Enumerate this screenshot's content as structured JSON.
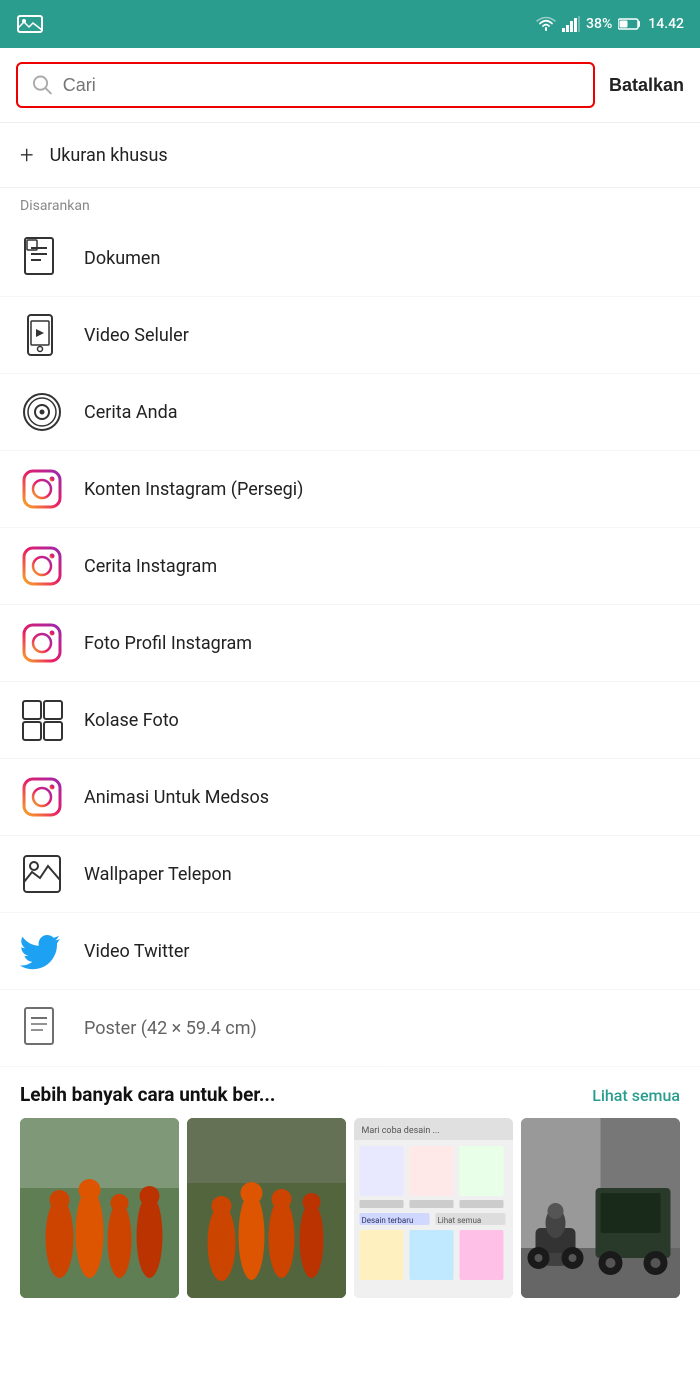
{
  "statusBar": {
    "wifi": "wifi",
    "signal": "signal",
    "battery": "38%",
    "time": "14.42"
  },
  "search": {
    "placeholder": "Cari",
    "cancelLabel": "Batalkan"
  },
  "customSize": {
    "icon": "plus",
    "label": "Ukuran khusus"
  },
  "suggestedLabel": "Disarankan",
  "items": [
    {
      "id": "dokumen",
      "label": "Dokumen",
      "iconType": "dokumen"
    },
    {
      "id": "video-seluler",
      "label": "Video Seluler",
      "iconType": "video-seluler"
    },
    {
      "id": "cerita-anda",
      "label": "Cerita Anda",
      "iconType": "cerita-anda"
    },
    {
      "id": "konten-instagram",
      "label": "Konten Instagram (Persegi)",
      "iconType": "instagram"
    },
    {
      "id": "cerita-instagram",
      "label": "Cerita Instagram",
      "iconType": "instagram-pink"
    },
    {
      "id": "foto-profil-instagram",
      "label": "Foto Profil Instagram",
      "iconType": "instagram-gradient"
    },
    {
      "id": "kolase-foto",
      "label": "Kolase Foto",
      "iconType": "kolase"
    },
    {
      "id": "animasi-medsos",
      "label": "Animasi Untuk Medsos",
      "iconType": "instagram-anim"
    },
    {
      "id": "wallpaper-telepon",
      "label": "Wallpaper Telepon",
      "iconType": "wallpaper"
    },
    {
      "id": "video-twitter",
      "label": "Video Twitter",
      "iconType": "twitter"
    },
    {
      "id": "poster",
      "label": "Poster (42 × 59.4 cm)",
      "iconType": "poster"
    }
  ],
  "bottomSection": {
    "title": "Lebih banyak cara untuk ber...",
    "seeAll": "Lihat semua"
  },
  "thumbnails": [
    {
      "id": "thumb1",
      "type": "people-orange"
    },
    {
      "id": "thumb2",
      "type": "people-orange2"
    },
    {
      "id": "thumb3",
      "type": "design-app"
    },
    {
      "id": "thumb4",
      "type": "motorcycle"
    }
  ]
}
